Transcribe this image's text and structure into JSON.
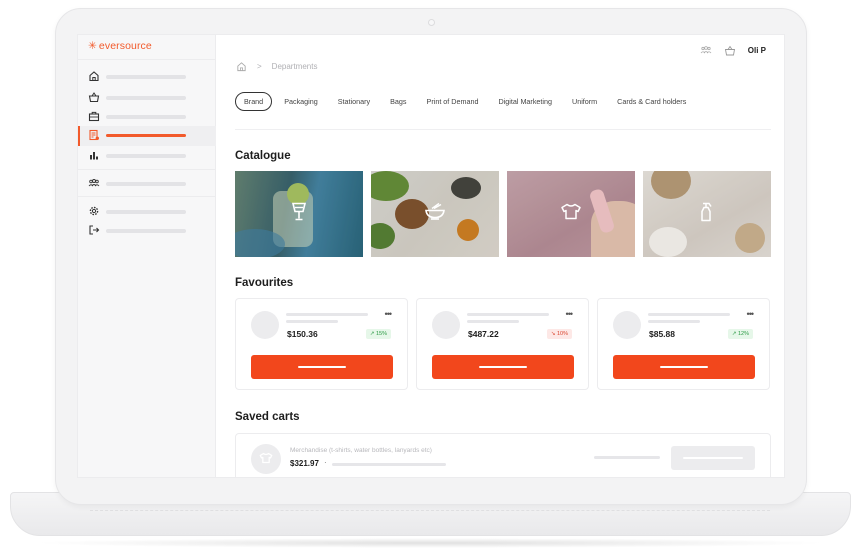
{
  "brand": {
    "logo_text": "eversource",
    "logo_symbol": "✳",
    "accent": "#f25a2b"
  },
  "sidebar": {
    "items": [
      {
        "icon": "home-icon"
      },
      {
        "icon": "basket-icon"
      },
      {
        "icon": "briefcase-icon"
      },
      {
        "icon": "document-list-icon",
        "active": true
      },
      {
        "icon": "bar-chart-icon"
      },
      {
        "icon": "team-icon"
      },
      {
        "icon": "settings-icon"
      },
      {
        "icon": "logout-icon"
      }
    ]
  },
  "header": {
    "user_name": "Oli P",
    "icons": [
      "team-icon",
      "basket-icon"
    ]
  },
  "breadcrumb": {
    "separator": ">",
    "current": "Departments"
  },
  "tabs": [
    {
      "label": "Brand",
      "active": true
    },
    {
      "label": "Packaging"
    },
    {
      "label": "Stationary"
    },
    {
      "label": "Bags"
    },
    {
      "label": "Print of Demand"
    },
    {
      "label": "Digital Marketing"
    },
    {
      "label": "Uniform"
    },
    {
      "label": "Cards & Card holders"
    }
  ],
  "catalogue": {
    "title": "Catalogue",
    "tiles": [
      {
        "icon": "cocktail-glass-icon"
      },
      {
        "icon": "food-bowl-icon"
      },
      {
        "icon": "tshirt-icon"
      },
      {
        "icon": "spray-bottle-icon"
      }
    ]
  },
  "favourites": {
    "title": "Favourites",
    "items": [
      {
        "price": "$150.36",
        "change": "15%",
        "trend": "up"
      },
      {
        "price": "$487.22",
        "change": "10%",
        "trend": "down"
      },
      {
        "price": "$85.88",
        "change": "12%",
        "trend": "up"
      }
    ],
    "colors": {
      "up": "#2b9a44",
      "down": "#d9452f",
      "button": "#f2471c"
    }
  },
  "saved_carts": {
    "title": "Saved carts",
    "items": [
      {
        "description": "Merchandise (t-shirts, water bottles, lanyards etc)",
        "price": "$321.97",
        "separator": "·"
      }
    ]
  }
}
